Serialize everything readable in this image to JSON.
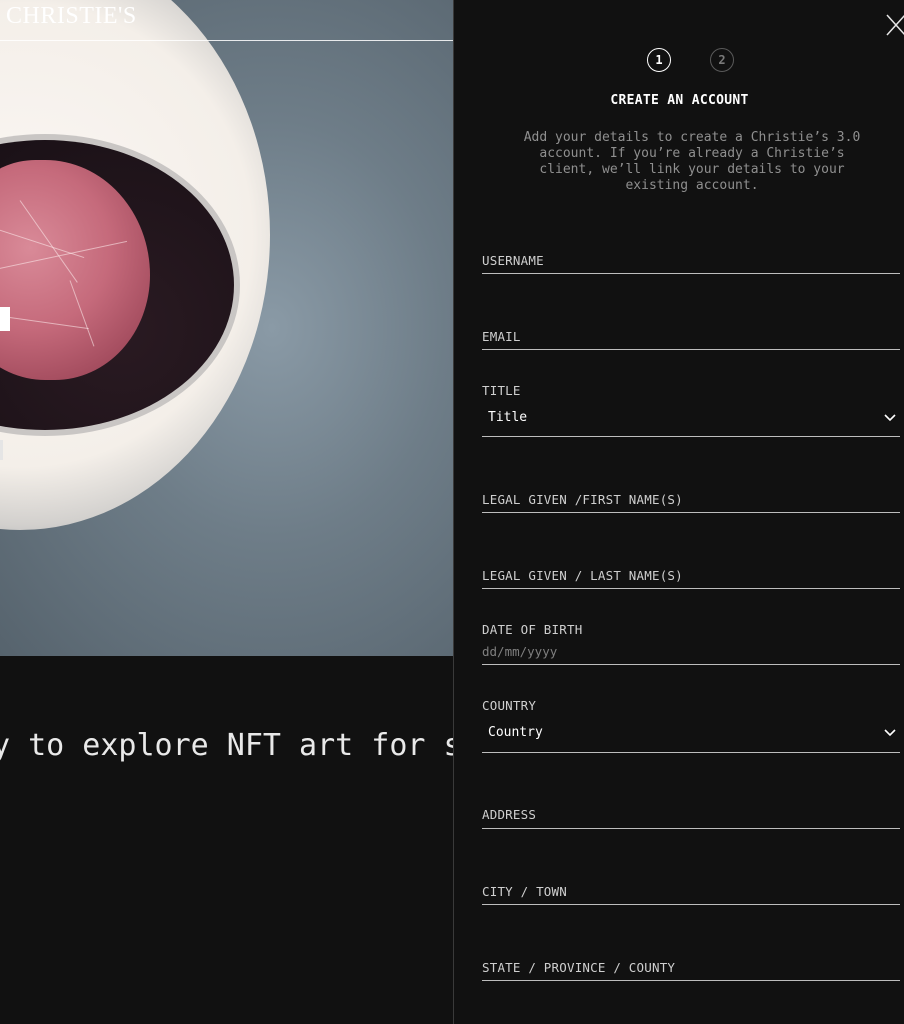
{
  "brand": "CHRISTIE'S",
  "marquee_text": "y to explore NFT art for s",
  "panel": {
    "steps": [
      "1",
      "2"
    ],
    "active_step": 1,
    "title": "CREATE AN ACCOUNT",
    "description": "Add your details to create a Christie’s 3.0 account. If you’re already a Christie’s client, we’ll link your details to your existing account.",
    "fields": {
      "username": {
        "label": "USERNAME"
      },
      "email": {
        "label": "EMAIL"
      },
      "title": {
        "label": "TITLE",
        "value": "Title"
      },
      "first_name": {
        "label": "LEGAL GIVEN /FIRST NAME(S)"
      },
      "last_name": {
        "label": "LEGAL GIVEN / LAST NAME(S)"
      },
      "dob": {
        "label": "DATE OF BIRTH",
        "placeholder": "dd/mm/yyyy"
      },
      "country": {
        "label": "COUNTRY",
        "value": "Country"
      },
      "address": {
        "label": "ADDRESS"
      },
      "city": {
        "label": "CITY / TOWN"
      },
      "state": {
        "label": "STATE / PROVINCE / COUNTY"
      }
    }
  },
  "icons": {
    "close": "close-icon",
    "chevron": "chevron-down-icon"
  },
  "colors": {
    "background": "#111111",
    "text": "#ffffff",
    "muted": "#8f8f8f",
    "line": "#bdbdbd"
  }
}
